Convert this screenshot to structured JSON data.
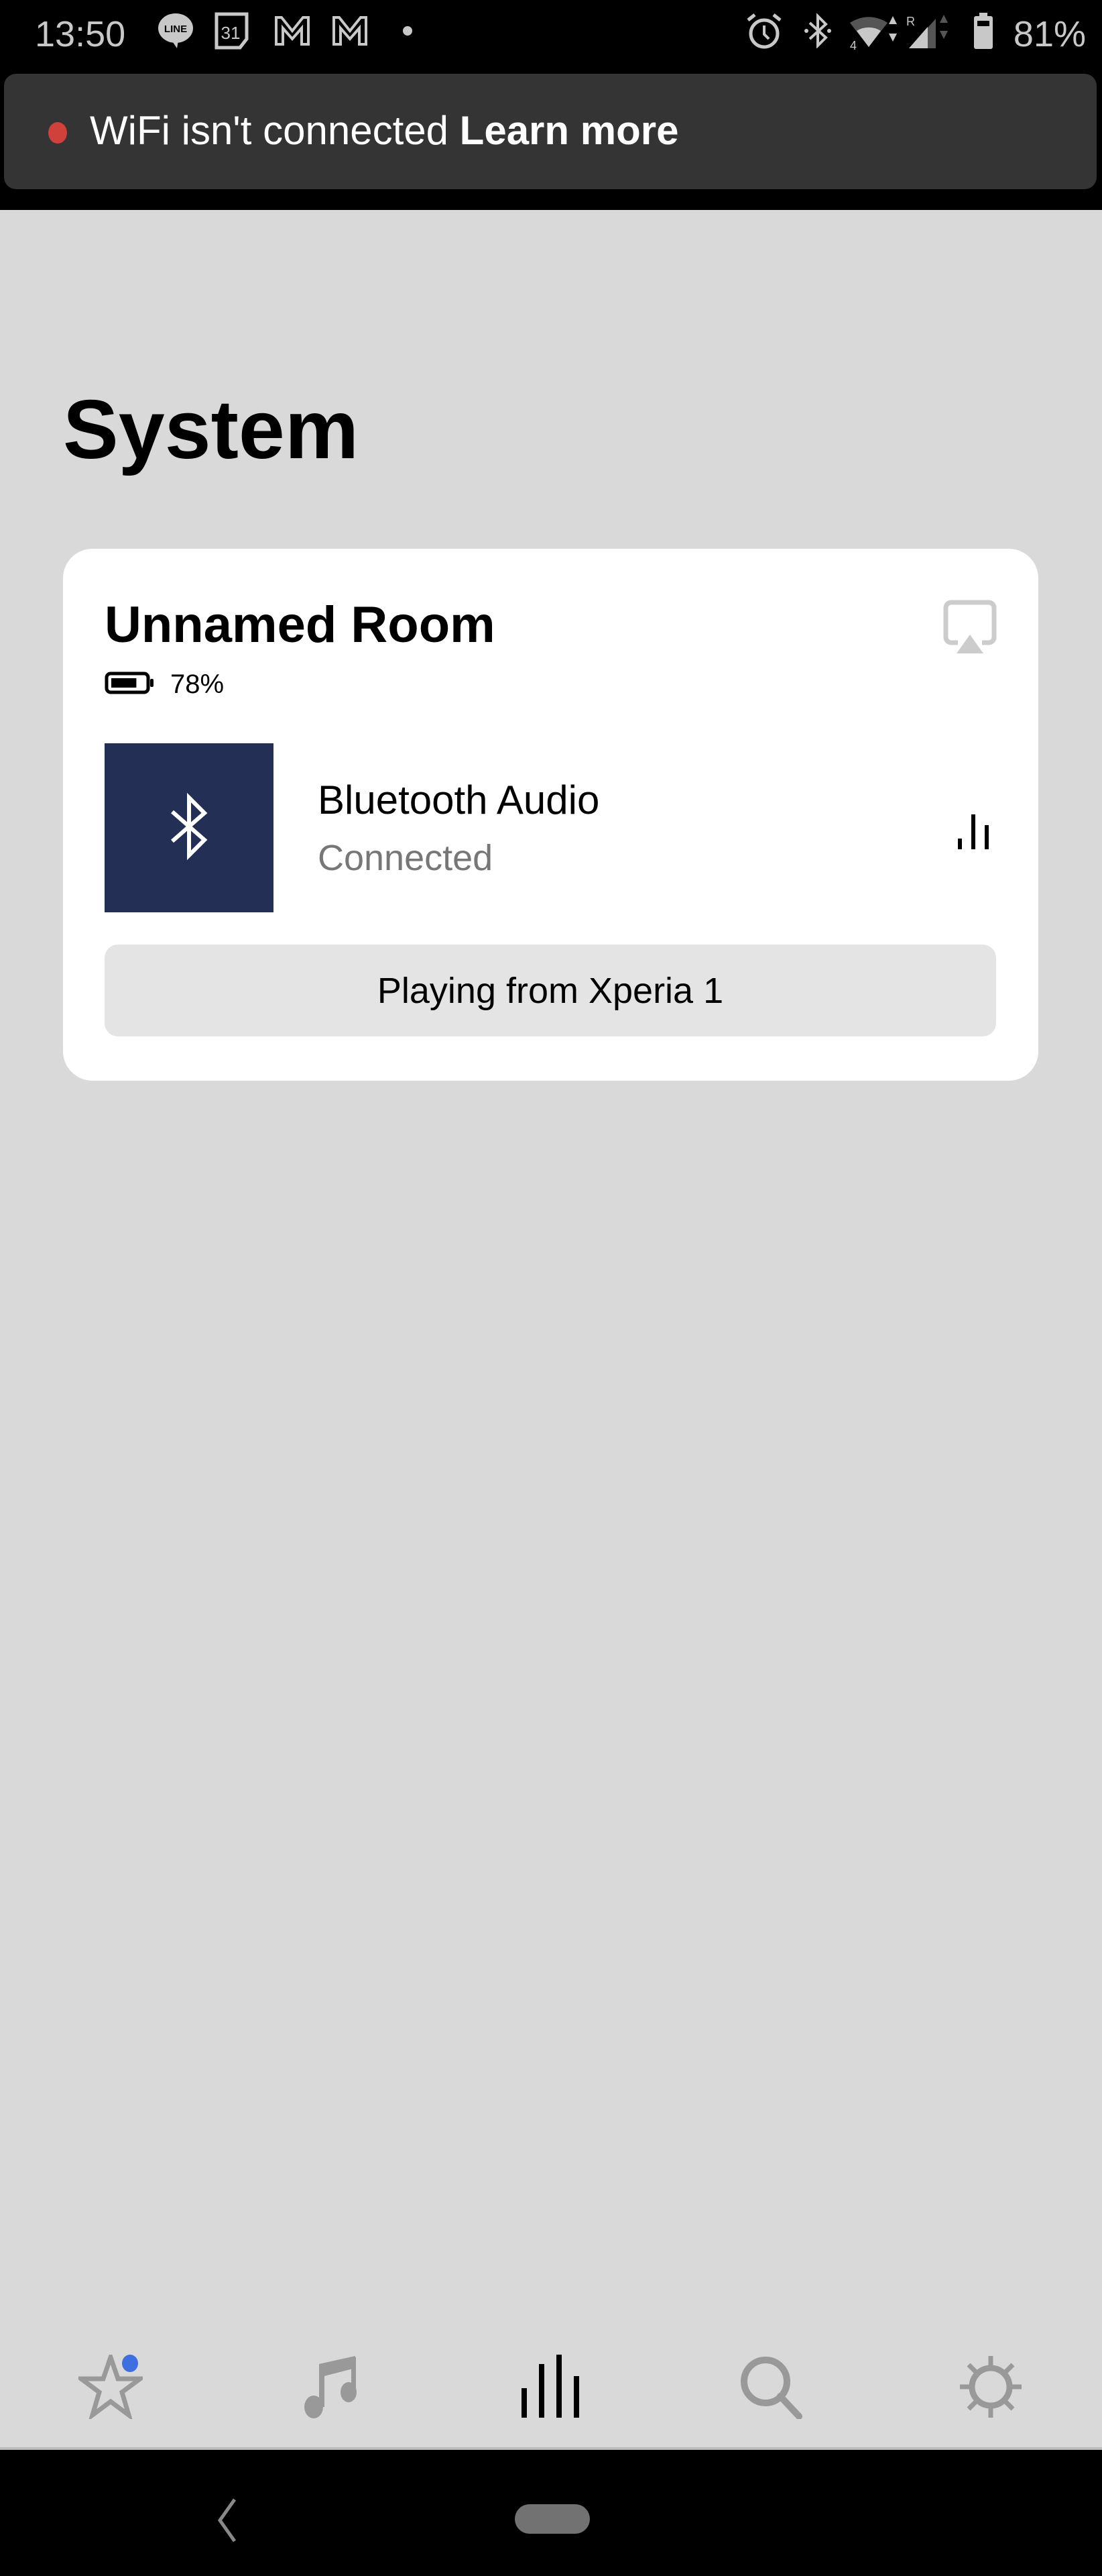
{
  "status_bar": {
    "time": "13:50",
    "notification_icons": [
      "line-icon",
      "calendar-icon",
      "gmail-icon",
      "gmail-icon",
      "more-dot-icon"
    ],
    "calendar_day": "31",
    "line_label": "LINE",
    "system_icons": [
      "alarm-icon",
      "bluetooth-icon",
      "wifi-icon",
      "signal-icon",
      "battery-icon"
    ],
    "wifi_badge": "4",
    "roaming_badge": "R",
    "battery_percent": "81%"
  },
  "banner": {
    "message": "WiFi isn't connected",
    "link": "Learn more",
    "dot_color": "#d0413b"
  },
  "page": {
    "title": "System"
  },
  "room_card": {
    "room_name": "Unnamed Room",
    "battery_percent": "78%",
    "battery_level": 0.78,
    "source": {
      "title": "Bluetooth Audio",
      "status": "Connected",
      "art_color": "#232f55"
    },
    "playing_label": "Playing from Xperia 1"
  },
  "tab_bar": {
    "tabs": [
      {
        "name": "favorites",
        "icon": "star-icon",
        "active": false,
        "badge": true
      },
      {
        "name": "browse",
        "icon": "music-note-icon",
        "active": false
      },
      {
        "name": "system",
        "icon": "equalizer-icon",
        "active": true
      },
      {
        "name": "search",
        "icon": "search-icon",
        "active": false
      },
      {
        "name": "settings",
        "icon": "gear-icon",
        "active": false
      }
    ],
    "badge_color": "#3e6fe0"
  },
  "nav_bar": {
    "buttons": [
      "back",
      "home"
    ]
  }
}
